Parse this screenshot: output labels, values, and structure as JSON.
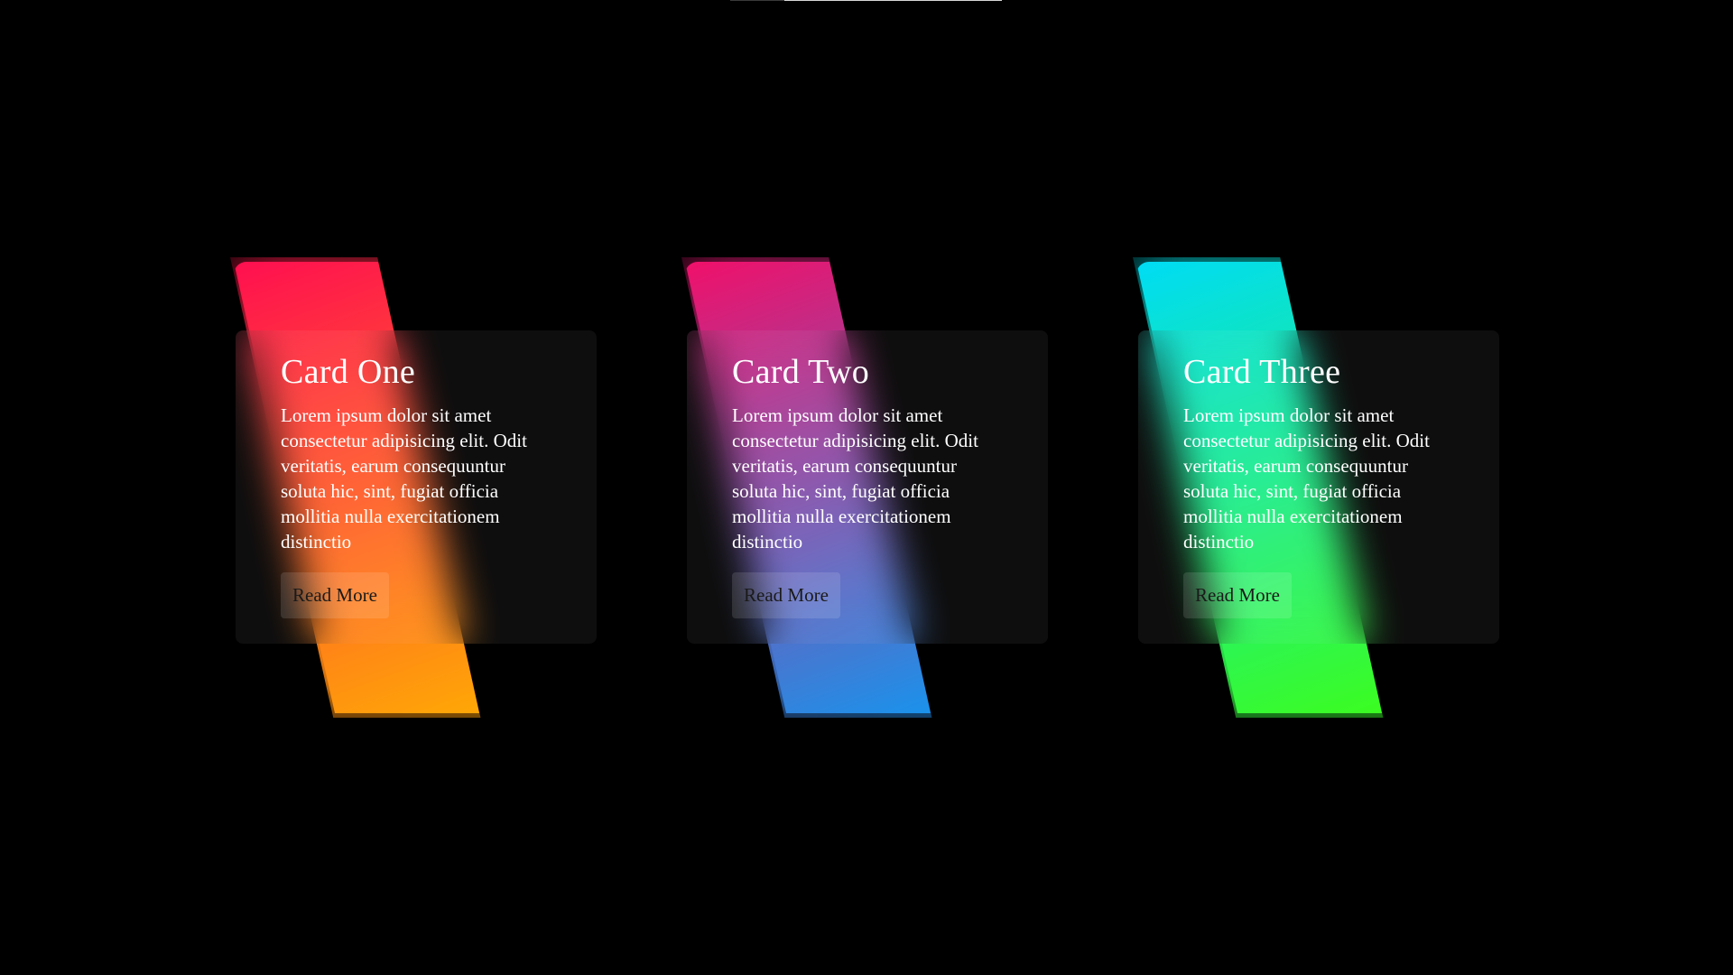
{
  "cards": [
    {
      "title": "Card One",
      "text": "Lorem ipsum dolor sit amet consectetur adipisicing elit. Odit veritatis, earum consequuntur soluta hic, sint, fugiat officia mollitia nulla exercitationem distinctio",
      "button_label": "Read More",
      "gradient_start": "#ff0f50",
      "gradient_end": "#ffb300"
    },
    {
      "title": "Card Two",
      "text": "Lorem ipsum dolor sit amet consectetur adipisicing elit. Odit veritatis, earum consequuntur soluta hic, sint, fugiat officia mollitia nulla exercitationem distinctio",
      "button_label": "Read More",
      "gradient_start": "#f0106a",
      "gradient_end": "#0a9cf5"
    },
    {
      "title": "Card Three",
      "text": "Lorem ipsum dolor sit amet consectetur adipisicing elit. Odit veritatis, earum consequuntur soluta hic, sint, fugiat officia mollitia nulla exercitationem distinctio",
      "button_label": "Read More",
      "gradient_start": "#00dcf5",
      "gradient_end": "#40ff10"
    }
  ]
}
